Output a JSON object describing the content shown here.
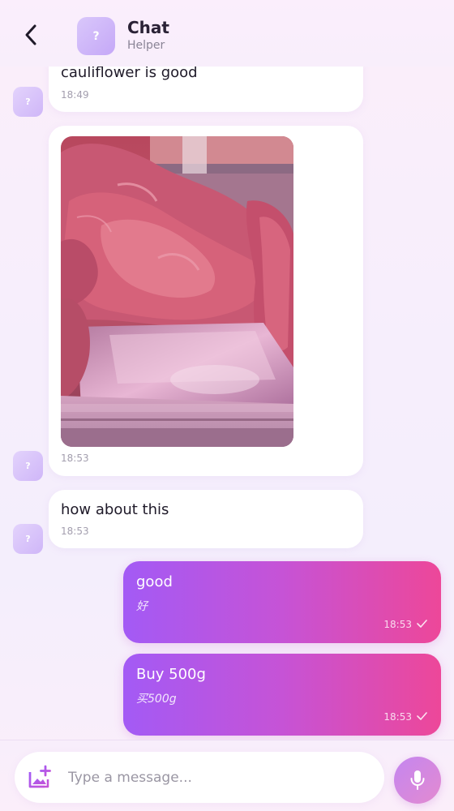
{
  "header": {
    "title": "Chat",
    "subtitle": "Helper",
    "avatar_glyph": "?"
  },
  "messages": [
    {
      "side": "in",
      "text": "cauliflower is good",
      "time": "18:49"
    },
    {
      "side": "in",
      "type": "image",
      "image_desc": "raw red meat at a butcher display counter",
      "time": "18:53"
    },
    {
      "side": "in",
      "text": "how about this",
      "time": "18:53"
    },
    {
      "side": "out",
      "text": "good",
      "translation": "好",
      "time": "18:53",
      "status": "sent"
    },
    {
      "side": "out",
      "text": "Buy 500g",
      "translation": "买500g",
      "time": "18:53",
      "status": "sent"
    }
  ],
  "avatar_glyph": "?",
  "composer": {
    "placeholder": "Type a message..."
  },
  "colors": {
    "accent_start": "#a35af5",
    "accent_end": "#ed4799"
  }
}
